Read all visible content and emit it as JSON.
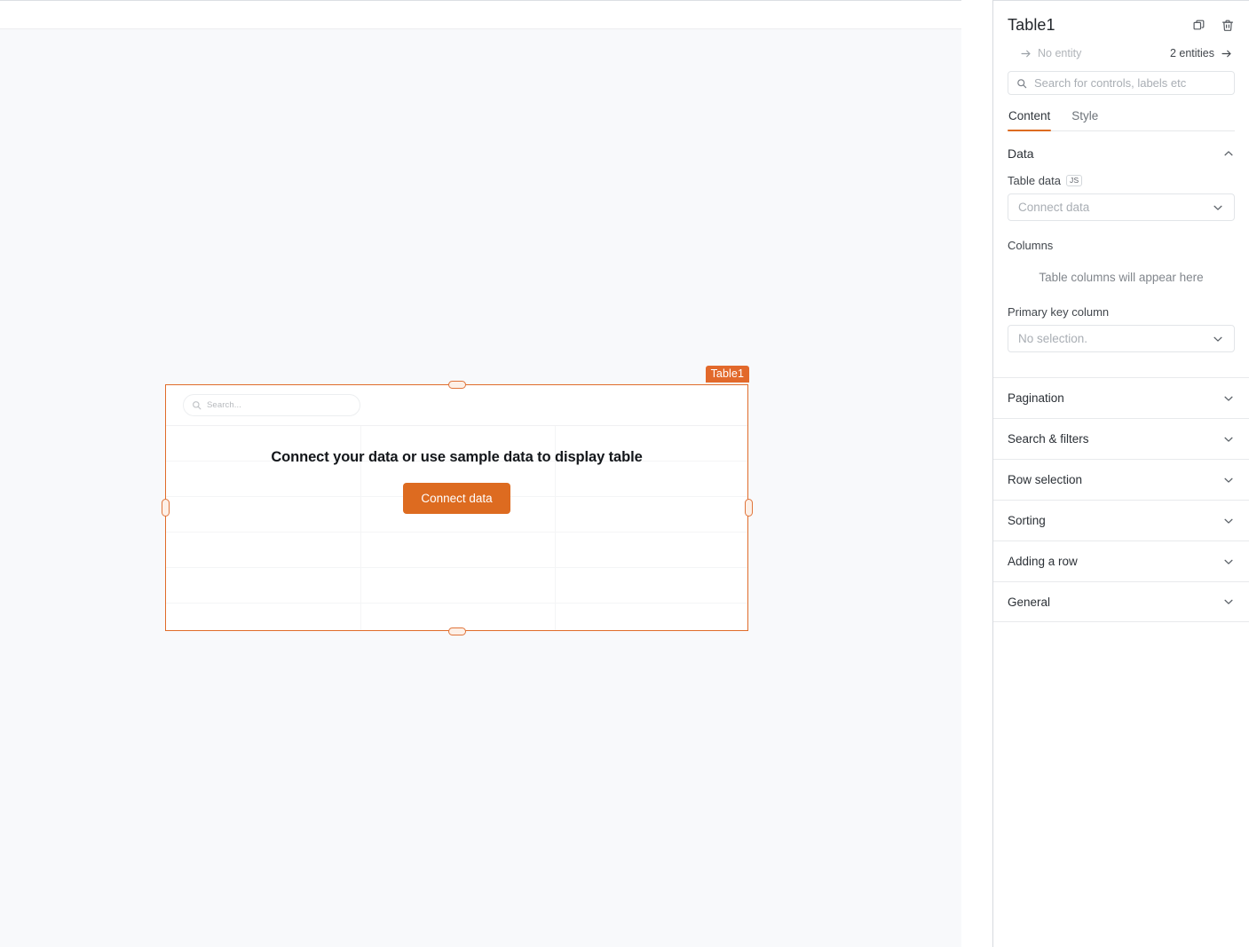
{
  "canvas": {
    "widget": {
      "name_badge": "Table1",
      "search_placeholder": "Search...",
      "empty_message": "Connect your data or use sample data to display table",
      "connect_button": "Connect data",
      "column_count": 3,
      "row_count": 6
    }
  },
  "panel": {
    "title": "Table1",
    "actions": {
      "duplicate_title": "Duplicate",
      "delete_title": "Delete"
    },
    "entity": {
      "left_label": "No entity",
      "right_label": "2 entities"
    },
    "search": {
      "placeholder": "Search for controls, labels etc",
      "value": ""
    },
    "tabs": [
      {
        "label": "Content",
        "active": true
      },
      {
        "label": "Style",
        "active": false
      }
    ],
    "data_section": {
      "title": "Data",
      "expanded": true,
      "table_data": {
        "label": "Table data",
        "badge": "JS",
        "value": "Connect data"
      },
      "columns": {
        "label": "Columns",
        "empty_text": "Table columns will appear here"
      },
      "primary_key": {
        "label": "Primary key column",
        "value": "No selection."
      }
    },
    "sections": [
      {
        "label": "Pagination"
      },
      {
        "label": "Search & filters"
      },
      {
        "label": "Row selection"
      },
      {
        "label": "Sorting"
      },
      {
        "label": "Adding a row"
      },
      {
        "label": "General"
      }
    ]
  },
  "colors": {
    "accent": "#dd6b20",
    "selection_border": "#e06c2a",
    "canvas_bg": "#f8f9fb",
    "panel_border": "#e8eaec"
  }
}
